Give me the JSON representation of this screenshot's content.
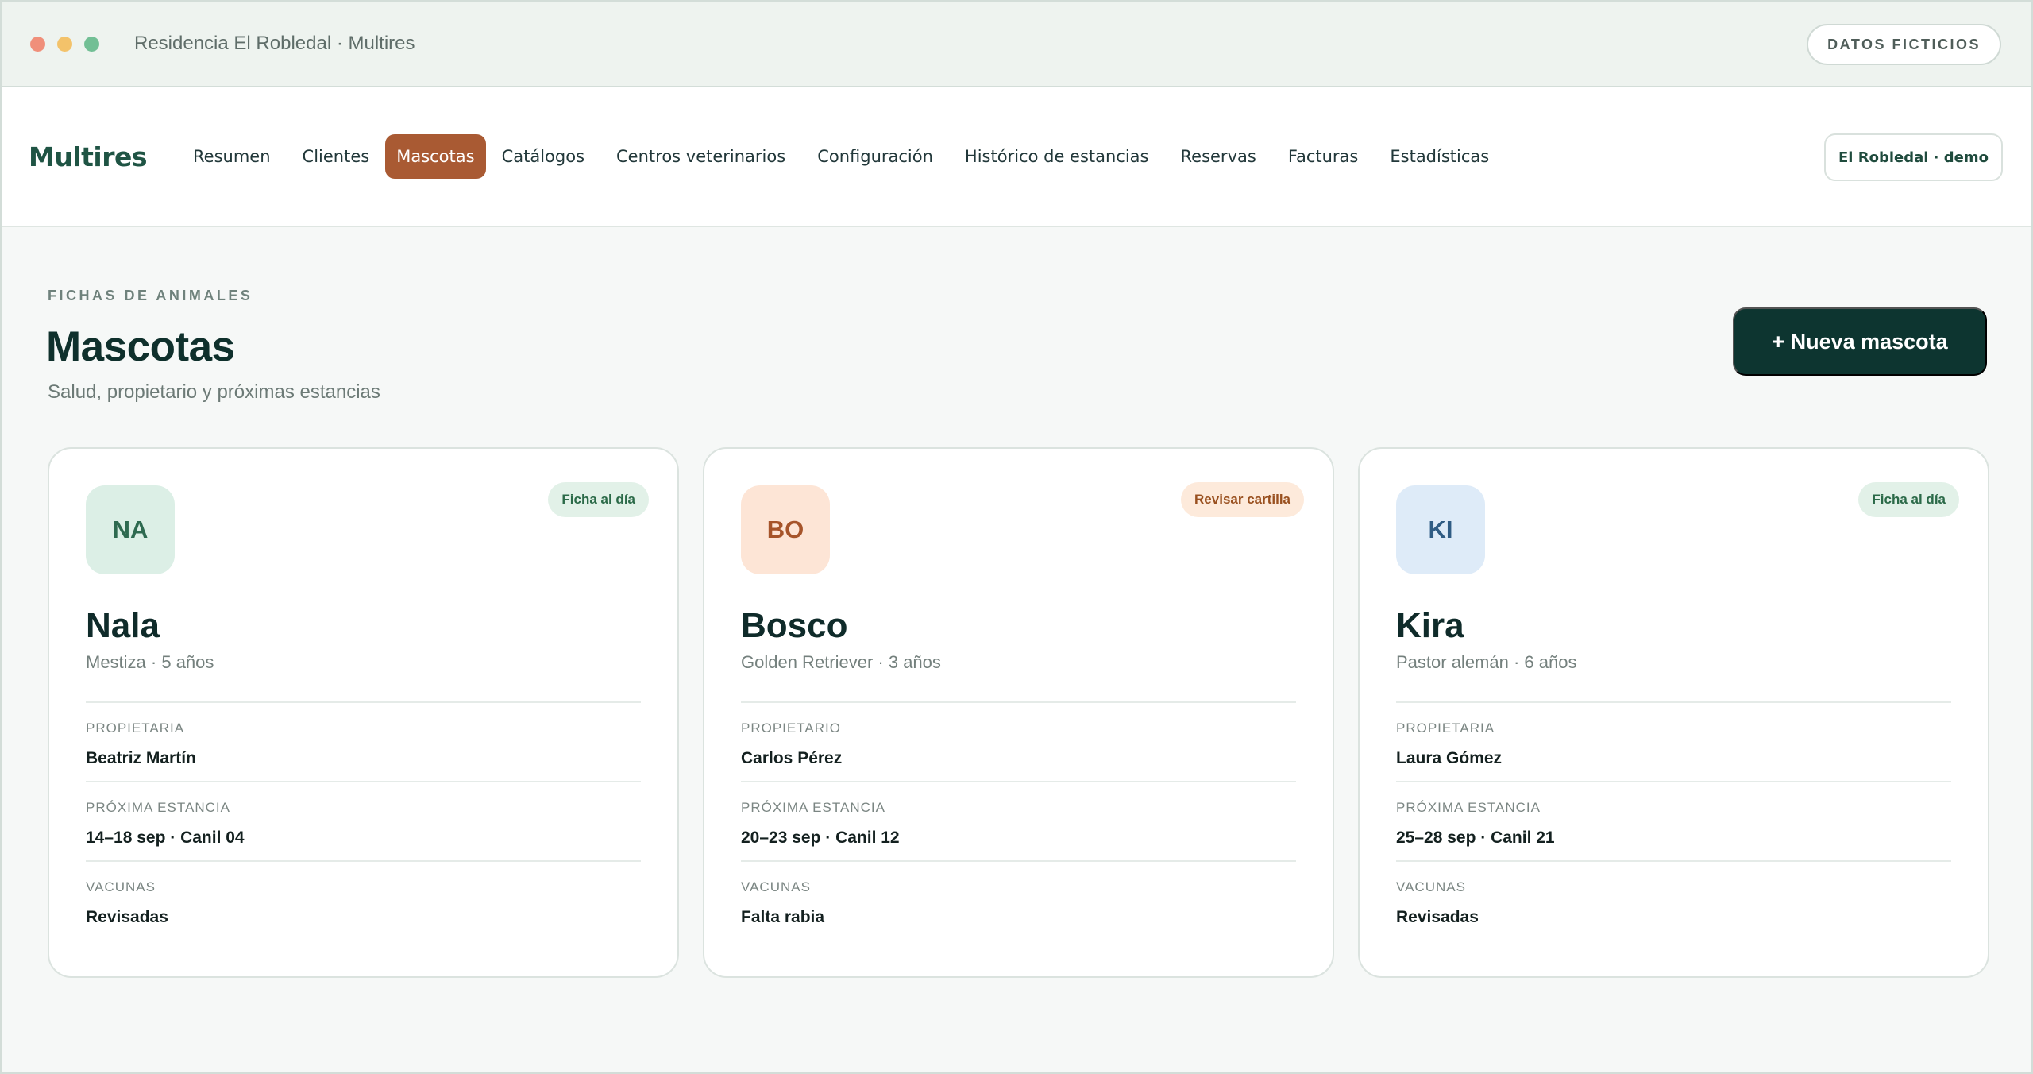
{
  "window": {
    "title": "Residencia El Robledal · Multires",
    "badge": "DATOS FICTICIOS",
    "controls": [
      "close",
      "minimize",
      "maximize"
    ]
  },
  "nav": {
    "brand": "Multires",
    "items": [
      {
        "label": "Resumen",
        "active": false
      },
      {
        "label": "Clientes",
        "active": false
      },
      {
        "label": "Mascotas",
        "active": true
      },
      {
        "label": "Catálogos",
        "active": false
      },
      {
        "label": "Centros veterinarios",
        "active": false
      },
      {
        "label": "Configuración",
        "active": false
      },
      {
        "label": "Histórico de estancias",
        "active": false
      },
      {
        "label": "Reservas",
        "active": false
      },
      {
        "label": "Facturas",
        "active": false
      },
      {
        "label": "Estadísticas",
        "active": false
      }
    ],
    "tenant": "El Robledal · demo"
  },
  "header": {
    "eyebrow": "FICHAS DE ANIMALES",
    "title": "Mascotas",
    "subtitle": "Salud, propietario y próximas estancias",
    "new_button": "+ Nueva mascota"
  },
  "colors": {
    "accent": "#a95a33",
    "primary_dark": "#0d3530",
    "brand": "#1f5444"
  },
  "pets": [
    {
      "initials": "NA",
      "name": "Nala",
      "meta": "Mestiza · 5 años",
      "status": "Ficha al día",
      "avatar_bg": "#dcefe6",
      "avatar_fg": "#2e6a50",
      "status_bg": "#e2f1e8",
      "status_fg": "#2b6a48",
      "owner_label": "PROPIETARIA",
      "owner": "Beatriz Martín",
      "stay_label": "PRÓXIMA ESTANCIA",
      "stay": "14–18 sep · Canil 04",
      "vaccines_label": "VACUNAS",
      "vaccines": "Revisadas"
    },
    {
      "initials": "BO",
      "name": "Bosco",
      "meta": "Golden Retriever · 3 años",
      "status": "Revisar cartilla",
      "avatar_bg": "#fde5d6",
      "avatar_fg": "#a6542a",
      "status_bg": "#fdeadb",
      "status_fg": "#99501f",
      "owner_label": "PROPIETARIO",
      "owner": "Carlos Pérez",
      "stay_label": "PRÓXIMA ESTANCIA",
      "stay": "20–23 sep · Canil 12",
      "vaccines_label": "VACUNAS",
      "vaccines": "Falta rabia"
    },
    {
      "initials": "KI",
      "name": "Kira",
      "meta": "Pastor alemán · 6 años",
      "status": "Ficha al día",
      "avatar_bg": "#deebf8",
      "avatar_fg": "#2f5c84",
      "status_bg": "#e2f1e8",
      "status_fg": "#2b6a48",
      "owner_label": "PROPIETARIA",
      "owner": "Laura Gómez",
      "stay_label": "PRÓXIMA ESTANCIA",
      "stay": "25–28 sep · Canil 21",
      "vaccines_label": "VACUNAS",
      "vaccines": "Revisadas"
    }
  ]
}
